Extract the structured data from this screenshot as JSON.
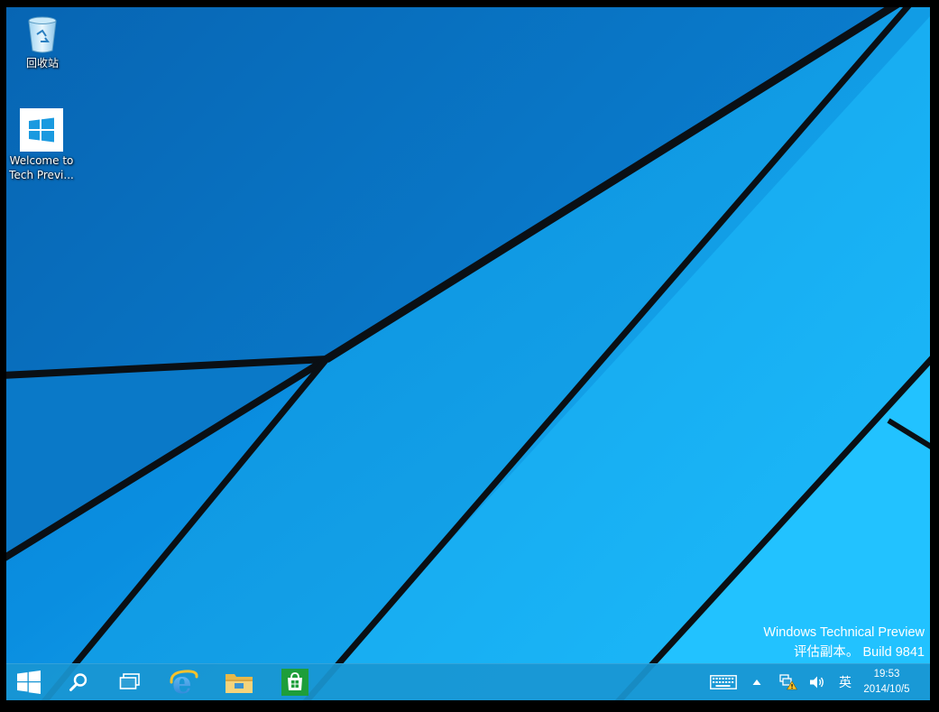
{
  "desktop": {
    "icons": [
      {
        "label": "回收站",
        "icon": "recycle-bin-icon"
      },
      {
        "label_line1": "Welcome to",
        "label_line2": "Tech Previ...",
        "icon": "windows-logo-icon"
      }
    ]
  },
  "watermark": {
    "line1": "Windows Technical Preview",
    "line2": "评估副本。 Build 9841"
  },
  "taskbar": {
    "start": "start-button",
    "search": "search-icon",
    "task_view": "task-view-icon",
    "pinned": [
      "internet-explorer-icon",
      "file-explorer-icon",
      "store-icon"
    ],
    "tray": {
      "keyboard": "touch-keyboard-icon",
      "show_hidden": "chevron-up-icon",
      "network": "network-warning-icon",
      "volume": "speaker-icon",
      "ime": "英"
    },
    "clock": {
      "time": "19:53",
      "date": "2014/10/5"
    }
  },
  "colors": {
    "wallpaper_dark": "#0a6fc0",
    "wallpaper_light": "#1ab4f5",
    "taskbar": "#1996d2",
    "store_green": "#1e9e3a"
  }
}
